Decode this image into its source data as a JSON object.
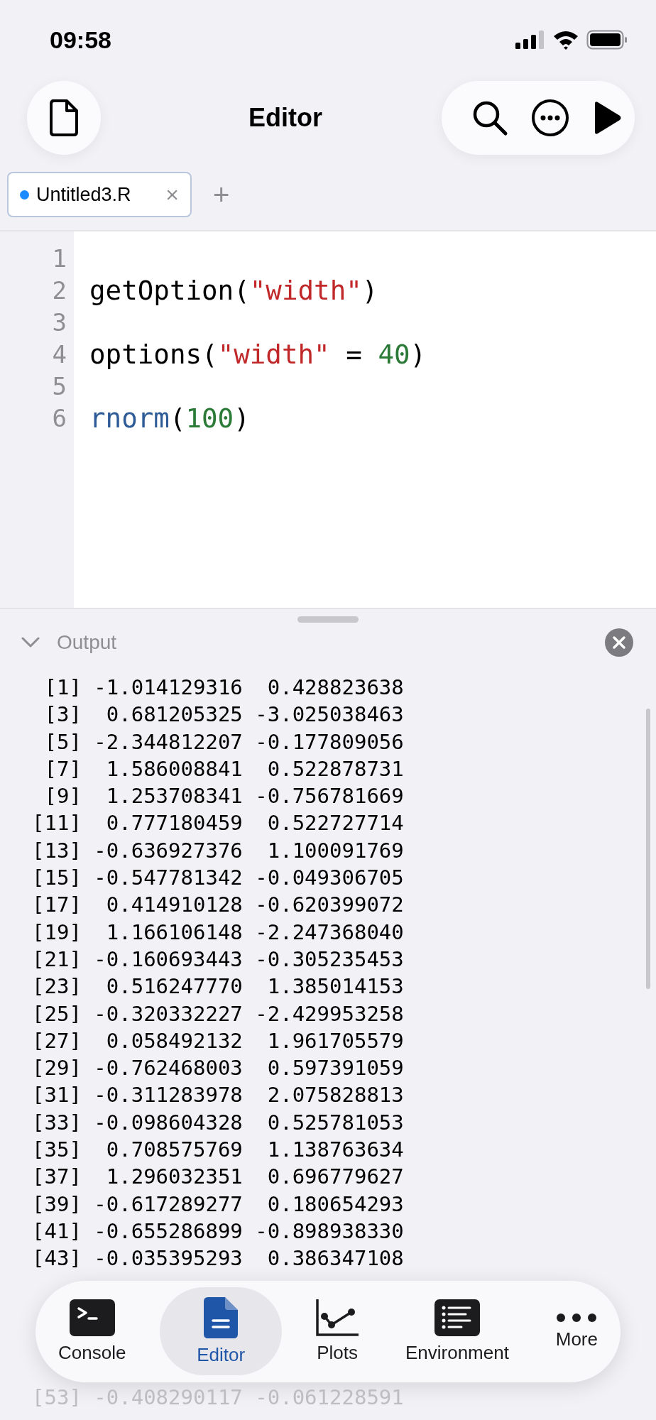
{
  "status_bar": {
    "time": "09:58"
  },
  "header": {
    "title": "Editor"
  },
  "tabs": [
    {
      "label": "Untitled3.R",
      "selected": true,
      "modified": true,
      "close": "×"
    }
  ],
  "add_tab": "+",
  "editor": {
    "lines": [
      {
        "number": "1"
      },
      {
        "number": "2",
        "tokens": [
          {
            "text": "getOption(",
            "kind": "plain"
          },
          {
            "text": "\"width\"",
            "kind": "string"
          },
          {
            "text": ")",
            "kind": "plain"
          }
        ]
      },
      {
        "number": "3"
      },
      {
        "number": "4",
        "tokens": [
          {
            "text": "options(",
            "kind": "plain"
          },
          {
            "text": "\"width\"",
            "kind": "string"
          },
          {
            "text": " = ",
            "kind": "plain"
          },
          {
            "text": "40",
            "kind": "number"
          },
          {
            "text": ")",
            "kind": "plain"
          }
        ]
      },
      {
        "number": "5"
      },
      {
        "number": "6",
        "tokens": [
          {
            "text": "rnorm",
            "kind": "function"
          },
          {
            "text": "(",
            "kind": "plain"
          },
          {
            "text": "100",
            "kind": "number"
          },
          {
            "text": ")",
            "kind": "plain"
          }
        ]
      }
    ]
  },
  "output": {
    "title": "Output",
    "expanded": true,
    "lines": [
      {
        "text": " [1] -1.014129316  0.428823638",
        "faded": false
      },
      {
        "text": " [3]  0.681205325 -3.025038463",
        "faded": false
      },
      {
        "text": " [5] -2.344812207 -0.177809056",
        "faded": false
      },
      {
        "text": " [7]  1.586008841  0.522878731",
        "faded": false
      },
      {
        "text": " [9]  1.253708341 -0.756781669",
        "faded": false
      },
      {
        "text": "[11]  0.777180459  0.522727714",
        "faded": false
      },
      {
        "text": "[13] -0.636927376  1.100091769",
        "faded": false
      },
      {
        "text": "[15] -0.547781342 -0.049306705",
        "faded": false
      },
      {
        "text": "[17]  0.414910128 -0.620399072",
        "faded": false
      },
      {
        "text": "[19]  1.166106148 -2.247368040",
        "faded": false
      },
      {
        "text": "[21] -0.160693443 -0.305235453",
        "faded": false
      },
      {
        "text": "[23]  0.516247770  1.385014153",
        "faded": false
      },
      {
        "text": "[25] -0.320332227 -2.429953258",
        "faded": false
      },
      {
        "text": "[27]  0.058492132  1.961705579",
        "faded": false
      },
      {
        "text": "[29] -0.762468003  0.597391059",
        "faded": false
      },
      {
        "text": "[31] -0.311283978  2.075828813",
        "faded": false
      },
      {
        "text": "[33] -0.098604328  0.525781053",
        "faded": false
      },
      {
        "text": "[35]  0.708575769  1.138763634",
        "faded": false
      },
      {
        "text": "[37]  1.296032351  0.696779627",
        "faded": false
      },
      {
        "text": "[39] -0.617289277  0.180654293",
        "faded": false
      },
      {
        "text": "[41] -0.655286899 -0.898938330",
        "faded": false
      },
      {
        "text": "[43] -0.035395293  0.386347108",
        "faded": false
      }
    ],
    "lines_below": [
      {
        "text": "[53] -0.408290117 -0.061228591",
        "faded": true
      }
    ]
  },
  "tab_bar": [
    {
      "label": "Console",
      "kind": "console",
      "selected": false
    },
    {
      "label": "Editor",
      "kind": "editor",
      "selected": true
    },
    {
      "label": "Plots",
      "kind": "plots",
      "selected": false
    },
    {
      "label": "Environment",
      "kind": "environment",
      "selected": false
    },
    {
      "label": "More",
      "kind": "more",
      "selected": false
    }
  ]
}
